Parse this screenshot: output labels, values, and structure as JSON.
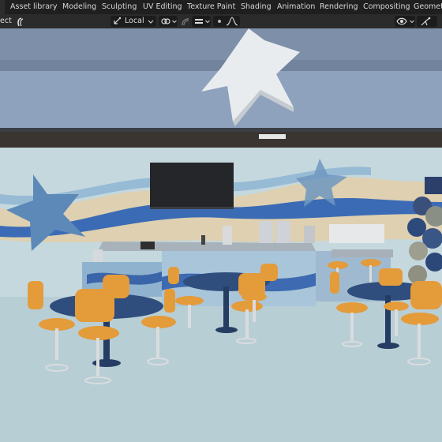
{
  "workspace_tabs": [
    {
      "label": "Asset library"
    },
    {
      "label": "Modeling"
    },
    {
      "label": "Sculpting"
    },
    {
      "label": "UV Editing"
    },
    {
      "label": "Texture Paint"
    },
    {
      "label": "Shading"
    },
    {
      "label": "Animation"
    },
    {
      "label": "Rendering"
    },
    {
      "label": "Compositing"
    },
    {
      "label": "Geometr"
    }
  ],
  "toolbar": {
    "mode_partial": "ect",
    "transform_orientation": "Local"
  },
  "viewport": {
    "description": "3D viewport showing cafe interior",
    "colors": {
      "wall": "#c5d6dc",
      "floor": "#b9cfd5",
      "ceiling": "#8a9bb2",
      "table": "#2f4f7f",
      "seat": "#e19a3a"
    }
  }
}
